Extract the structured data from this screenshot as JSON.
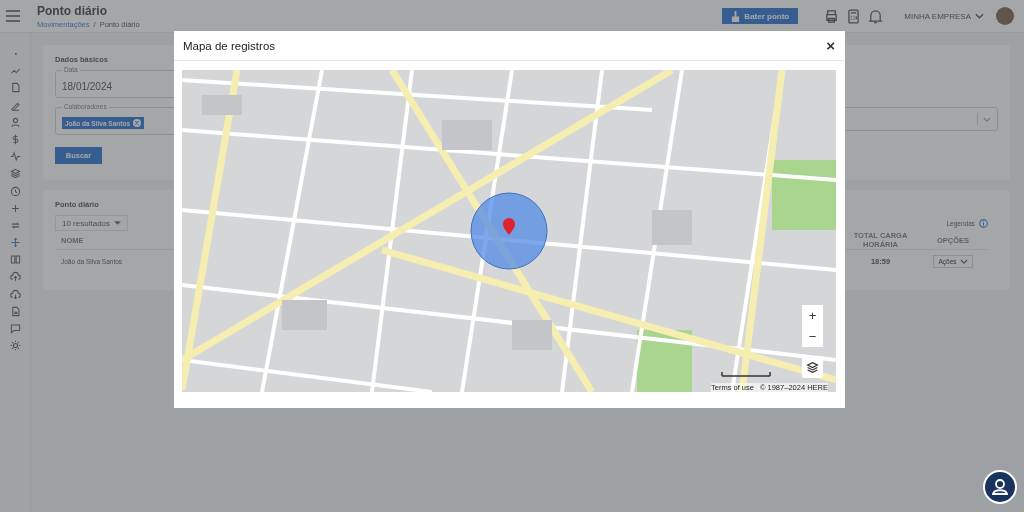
{
  "header": {
    "title": "Ponto diário",
    "breadcrumb": [
      {
        "label": "Movimentações",
        "link": true
      },
      {
        "label": "Ponto diário",
        "link": false
      }
    ],
    "breadcrumb_separator": "/",
    "clock_button": "Bater ponto",
    "company": "MINHA EMPRESA"
  },
  "sidebar": {
    "items": [
      {
        "selected": false
      },
      {
        "selected": false
      },
      {
        "selected": false
      },
      {
        "selected": false
      },
      {
        "selected": false
      },
      {
        "selected": false
      },
      {
        "selected": false
      },
      {
        "selected": false
      },
      {
        "selected": false
      },
      {
        "selected": false
      },
      {
        "selected": false
      },
      {
        "selected": true
      },
      {
        "selected": false
      },
      {
        "selected": false
      },
      {
        "selected": false
      },
      {
        "selected": false
      },
      {
        "selected": false
      },
      {
        "selected": false
      }
    ]
  },
  "filters": {
    "title": "Dados básicos",
    "date": {
      "label": "Data",
      "value": "18/01/2024"
    },
    "collaborators": {
      "label": "Colaboradores",
      "chips": [
        "João da Silva Santos"
      ]
    },
    "search_button": "Buscar"
  },
  "results": {
    "title": "Ponto diário",
    "page_size": "10 resultados",
    "legend": "Legendas",
    "columns": [
      "NOME",
      "TOTAL CARGA HORÁRIA",
      "OPÇÕES"
    ],
    "rows": [
      {
        "name": "João da Silva Santos",
        "total": "18:59",
        "action": "Ações"
      }
    ]
  },
  "modal": {
    "title": "Mapa de registros",
    "close": "×",
    "map": {
      "zoom_in": "+",
      "zoom_out": "−",
      "terms": "Terms of use",
      "copyright": "© 1987–2024 HERE"
    }
  }
}
